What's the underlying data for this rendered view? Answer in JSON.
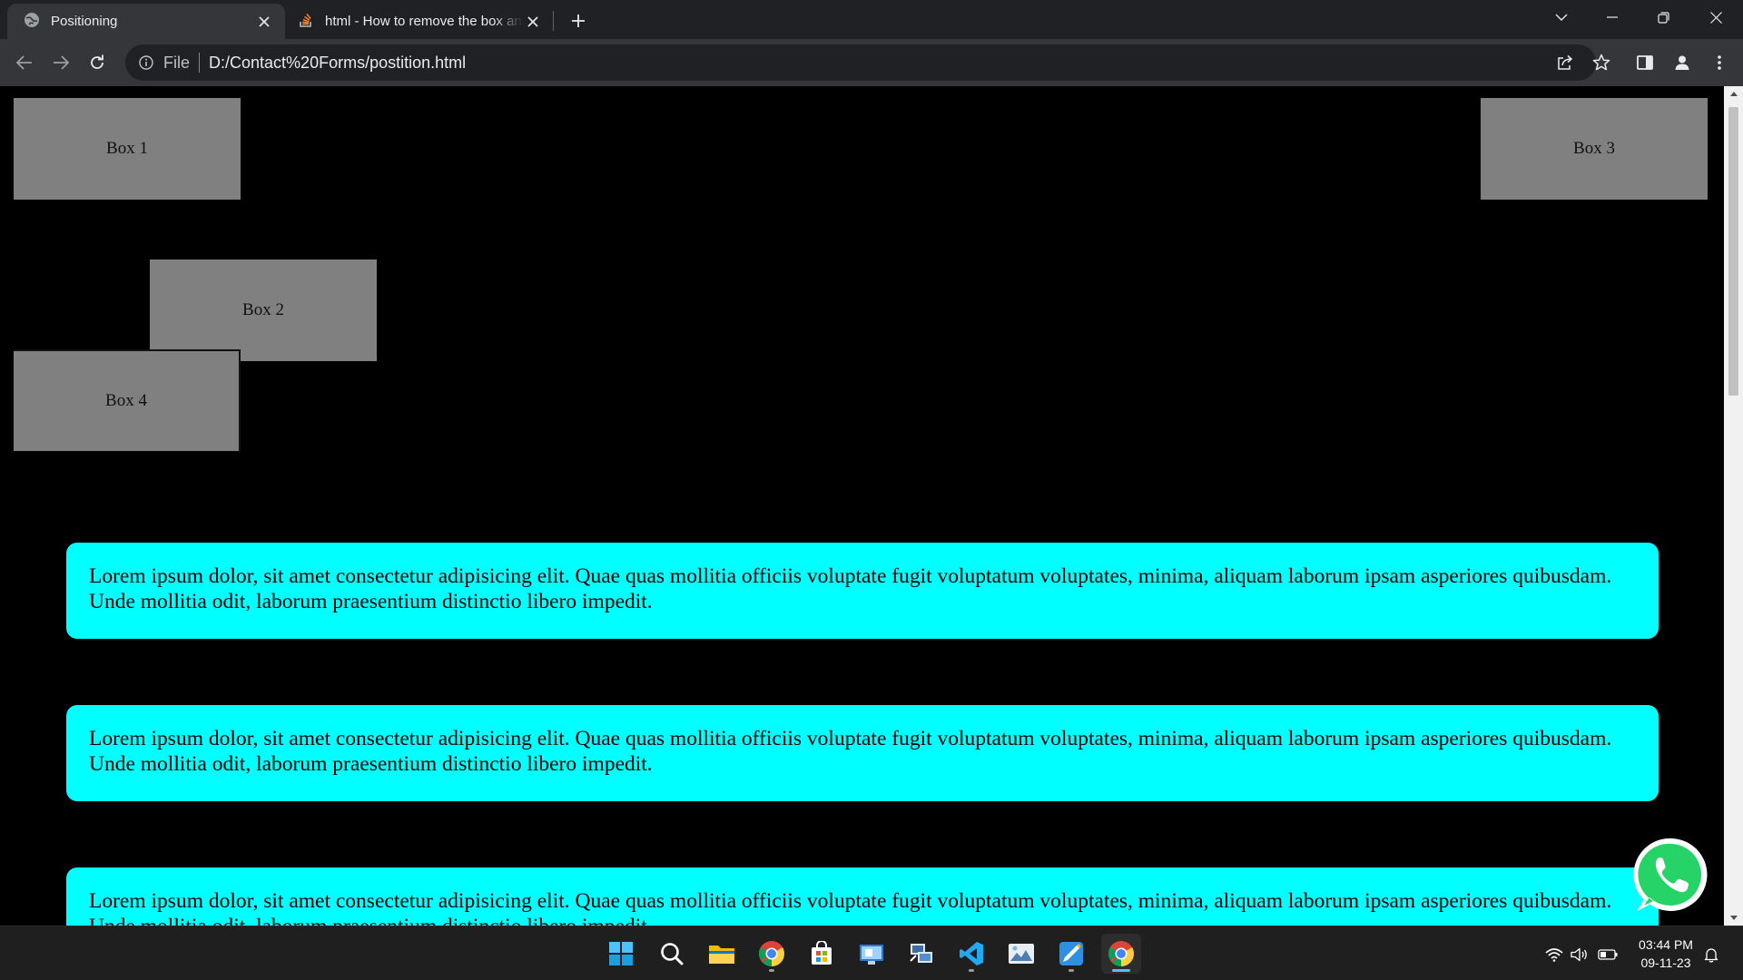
{
  "browser": {
    "tabs": [
      {
        "title": "Positioning",
        "icon": "globe-icon",
        "active": true
      },
      {
        "title": "html - How to remove the box and",
        "icon": "stackoverflow-icon",
        "active": false
      }
    ],
    "address": {
      "scheme_label": "File",
      "url": "D:/Contact%20Forms/postition.html"
    }
  },
  "page": {
    "boxes": [
      {
        "label": "Box 1"
      },
      {
        "label": "Box 2"
      },
      {
        "label": "Box 3"
      },
      {
        "label": "Box 4"
      }
    ],
    "paragraphs": [
      "Lorem ipsum dolor, sit amet consectetur adipisicing elit. Quae quas mollitia officiis voluptate fugit voluptatum voluptates, minima, aliquam laborum ipsam asperiores quibusdam. Unde mollitia odit, laborum praesentium distinctio libero impedit.",
      "Lorem ipsum dolor, sit amet consectetur adipisicing elit. Quae quas mollitia officiis voluptate fugit voluptatum voluptates, minima, aliquam laborum ipsam asperiores quibusdam. Unde mollitia odit, laborum praesentium distinctio libero impedit.",
      "Lorem ipsum dolor, sit amet consectetur adipisicing elit. Quae quas mollitia officiis voluptate fugit voluptatum voluptates, minima, aliquam laborum ipsam asperiores quibusdam. Unde mollitia odit, laborum praesentium distinctio libero impedit."
    ],
    "colors": {
      "background": "#000000",
      "box": "#808080",
      "paragraph_bg": "#00ffff",
      "whatsapp": "#25d366"
    }
  },
  "taskbar": {
    "apps": [
      "windows-start-icon",
      "search-icon",
      "file-explorer-icon",
      "chrome-icon",
      "microsoft-store-icon",
      "control-panel-icon",
      "remote-desktop-icon",
      "vscode-icon",
      "photos-icon",
      "paint-icon",
      "chrome-icon"
    ],
    "tray": [
      "wifi-icon",
      "volume-icon",
      "battery-icon"
    ],
    "clock": {
      "time": "03:44 PM",
      "date": "09-11-23"
    }
  }
}
